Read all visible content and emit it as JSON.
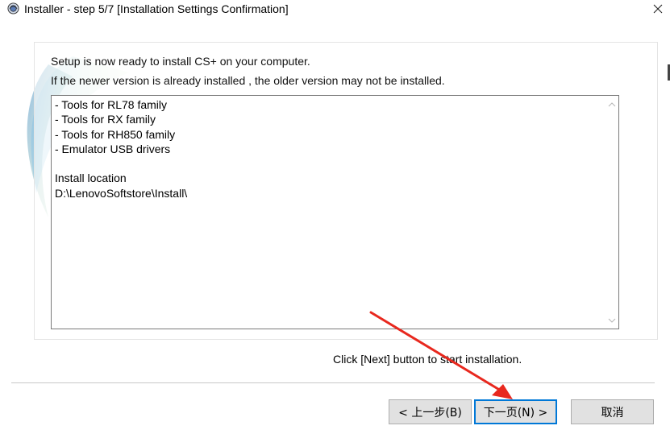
{
  "window": {
    "title": "Installer - step 5/7 [Installation Settings Confirmation]",
    "close_glyph": "✕"
  },
  "body": {
    "line1": "Setup is now ready to install CS+ on your computer.",
    "line2": "If the newer version is already installed , the older version may not be installed."
  },
  "summary": {
    "lines": [
      "- Tools for RL78 family",
      "- Tools for RX family",
      "- Tools for RH850 family",
      "- Emulator USB drivers",
      "",
      "Install location",
      "D:\\LenovoSoftstore\\Install\\"
    ]
  },
  "hint": "Click [Next] button to start installation.",
  "buttons": {
    "back": "< 上一步(B)",
    "next": "下一页(N) >",
    "cancel": "取消"
  },
  "colors": {
    "annotation_arrow": "#e8281e",
    "focus_border": "#0078d7"
  },
  "icons": {
    "app": "installer-globe-icon",
    "close": "close-icon",
    "scroll_up": "chevron-up-icon",
    "scroll_down": "chevron-down-icon"
  }
}
